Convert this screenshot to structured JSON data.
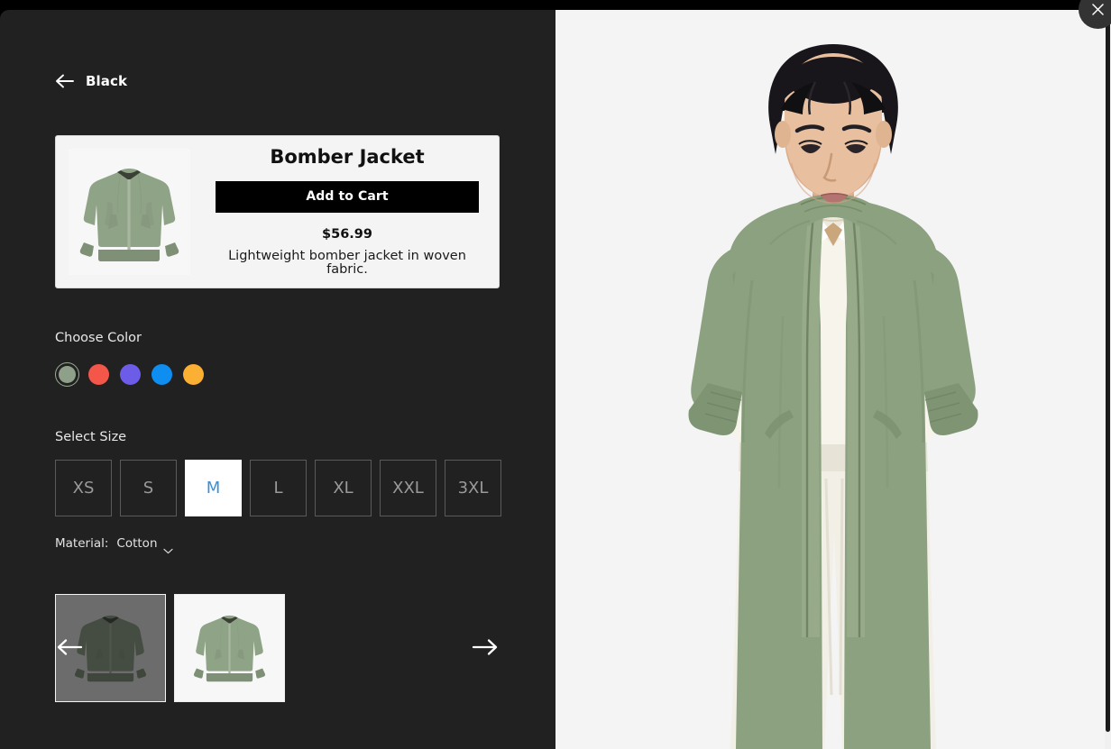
{
  "window": {
    "close_label": "×"
  },
  "nav": {
    "back_label": "Black",
    "back_icon": "arrow-left-icon"
  },
  "product": {
    "title": "Bomber Jacket",
    "add_to_cart_label": "Add to Cart",
    "price": "$56.99",
    "description": "Lightweight bomber jacket in woven fabric.",
    "thumb_alt": "green-bomber-jacket"
  },
  "color_section": {
    "label": "Choose Color",
    "selected_index": 0,
    "swatches": [
      {
        "name": "sage-green",
        "hex": "#8fa08a",
        "selected": true
      },
      {
        "name": "red",
        "hex": "#f4574a",
        "selected": false
      },
      {
        "name": "purple",
        "hex": "#6d5ce8",
        "selected": false
      },
      {
        "name": "blue",
        "hex": "#0d8ef0",
        "selected": false
      },
      {
        "name": "amber",
        "hex": "#fbb033",
        "selected": false
      }
    ]
  },
  "size_section": {
    "label": "Select Size",
    "selected": "M",
    "sizes": [
      "XS",
      "S",
      "M",
      "L",
      "XL",
      "XXL",
      "3XL"
    ]
  },
  "material": {
    "label": "Material:",
    "value": "Cotton",
    "chevron_icon": "chevron-down-icon"
  },
  "carousel": {
    "prev_icon": "arrow-left-icon",
    "next_icon": "arrow-right-icon",
    "thumbnails": [
      {
        "name": "jacket-thumb-1",
        "state": "dimmed",
        "selected": false
      },
      {
        "name": "jacket-thumb-2",
        "state": "normal",
        "selected": true
      }
    ]
  },
  "hero": {
    "alt": "model-wearing-green-bomber-jacket"
  },
  "colors": {
    "panel_dark": "#212121",
    "panel_light": "#f4f4f4",
    "accent_blue": "#3b8fd4",
    "card_bg": "#f4f4f4",
    "button_black": "#000000"
  }
}
